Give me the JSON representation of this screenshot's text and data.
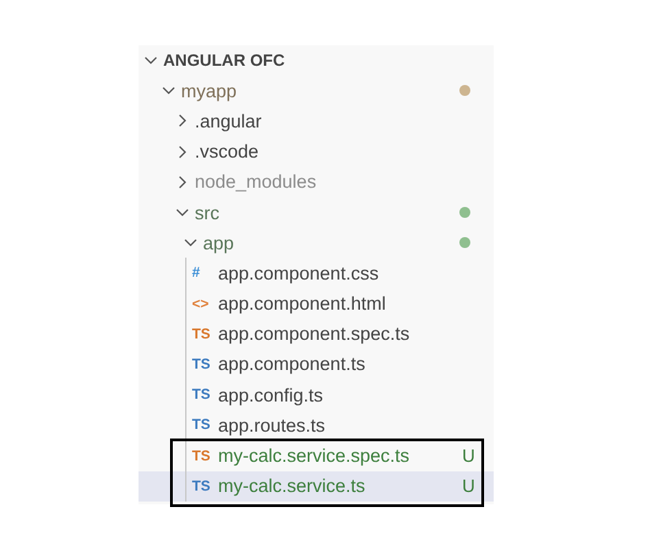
{
  "explorer": {
    "title": "ANGULAR OFC",
    "expanded": true,
    "children": [
      {
        "name": "myapp",
        "kind": "folder",
        "expanded": true,
        "color": "#cdb590",
        "dot": true,
        "children": [
          {
            "name": ".angular",
            "kind": "folder",
            "expanded": false,
            "dot": false
          },
          {
            "name": ".vscode",
            "kind": "folder",
            "expanded": false,
            "dot": false
          },
          {
            "name": "node_modules",
            "kind": "folder",
            "expanded": false,
            "color": "#8c8c8c",
            "dot": false
          },
          {
            "name": "src",
            "kind": "folder",
            "expanded": true,
            "color": "#8fbf8f",
            "dot": true,
            "children": [
              {
                "name": "app",
                "kind": "folder",
                "expanded": true,
                "color": "#8fbf8f",
                "dot": true,
                "children": [
                  {
                    "name": "app.component.css",
                    "kind": "file",
                    "icon": {
                      "glyph": "#",
                      "color": "#3c8fd6"
                    },
                    "selected": false,
                    "framed": false
                  },
                  {
                    "name": "app.component.html",
                    "kind": "file",
                    "icon": {
                      "glyph": "<>",
                      "color": "#e0813c"
                    },
                    "selected": false,
                    "framed": false
                  },
                  {
                    "name": "app.component.spec.ts",
                    "kind": "file",
                    "icon": {
                      "glyph": "TS",
                      "color": "#d9782d"
                    },
                    "selected": false,
                    "framed": false
                  },
                  {
                    "name": "app.component.ts",
                    "kind": "file",
                    "icon": {
                      "glyph": "TS",
                      "color": "#3d7bbf"
                    },
                    "selected": false,
                    "framed": false
                  },
                  {
                    "name": "app.config.ts",
                    "kind": "file",
                    "icon": {
                      "glyph": "TS",
                      "color": "#3d7bbf"
                    },
                    "selected": false,
                    "framed": false
                  },
                  {
                    "name": "app.routes.ts",
                    "kind": "file",
                    "icon": {
                      "glyph": "TS",
                      "color": "#3d7bbf"
                    },
                    "selected": false,
                    "framed": false
                  },
                  {
                    "name": "my-calc.service.spec.ts",
                    "kind": "file",
                    "icon": {
                      "glyph": "TS",
                      "color": "#d9782d"
                    },
                    "color": "#3d7f3d",
                    "badge": "U",
                    "selected": false,
                    "framed": true
                  },
                  {
                    "name": "my-calc.service.ts",
                    "kind": "file",
                    "icon": {
                      "glyph": "TS",
                      "color": "#3d7bbf"
                    },
                    "color": "#3d7f3d",
                    "badge": "U",
                    "selected": true,
                    "framed": true
                  }
                ]
              }
            ]
          }
        ]
      }
    ]
  }
}
